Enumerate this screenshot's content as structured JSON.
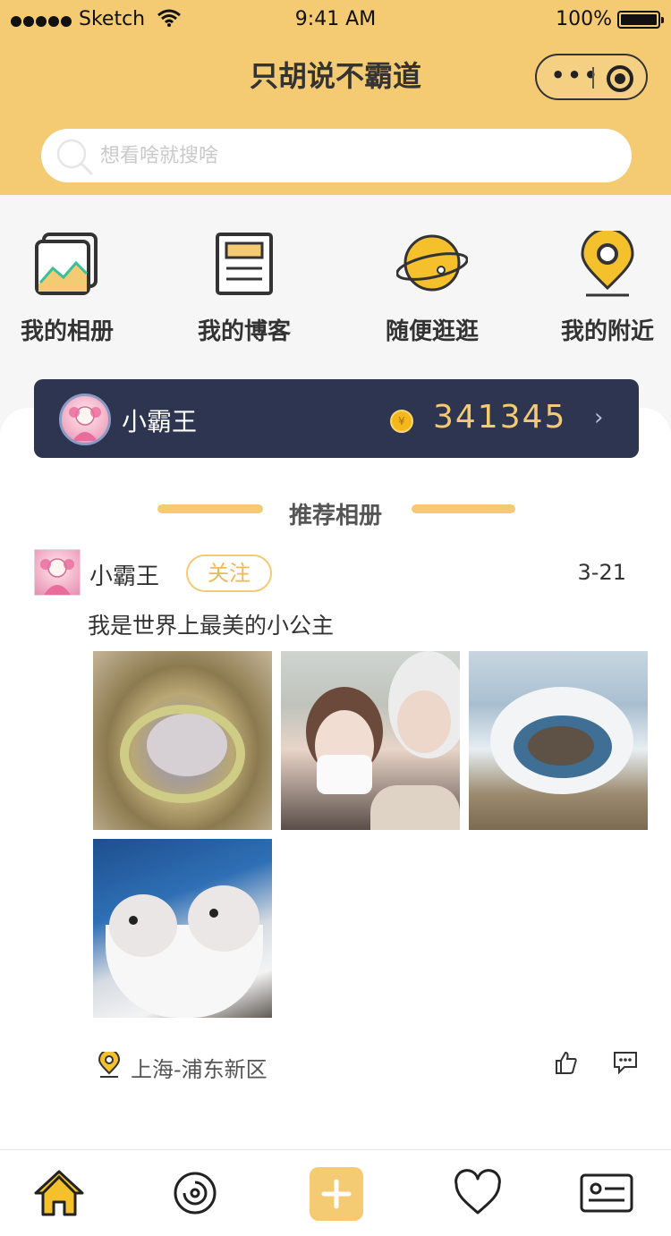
{
  "status_bar": {
    "carrier": "Sketch",
    "time": "9:41 AM",
    "battery": "100%"
  },
  "header": {
    "title": "只胡说不霸道",
    "search_placeholder": "想看啥就搜啥"
  },
  "quick_nav": [
    {
      "label": "我的相册",
      "icon": "photo-album-icon"
    },
    {
      "label": "我的博客",
      "icon": "blog-icon"
    },
    {
      "label": "随便逛逛",
      "icon": "planet-icon"
    },
    {
      "label": "我的附近",
      "icon": "location-pin-icon"
    }
  ],
  "account": {
    "name": "小霸王",
    "points": "341345"
  },
  "section": {
    "title": "推荐相册"
  },
  "post": {
    "author": "小霸王",
    "follow_label": "关注",
    "date": "3-21",
    "text": "我是世界上最美的小公主",
    "photos": [
      "hamster-in-bowl",
      "selfie-couple",
      "hamster-in-shell-house",
      "two-hamsters-in-cup"
    ],
    "location": "上海-浦东新区"
  },
  "colors": {
    "accent": "#f4ca72",
    "account_bg": "#2d3550",
    "points": "#f4ca72"
  },
  "tabbar": [
    "home-icon",
    "discover-icon",
    "add-icon",
    "favorite-icon",
    "profile-card-icon"
  ]
}
